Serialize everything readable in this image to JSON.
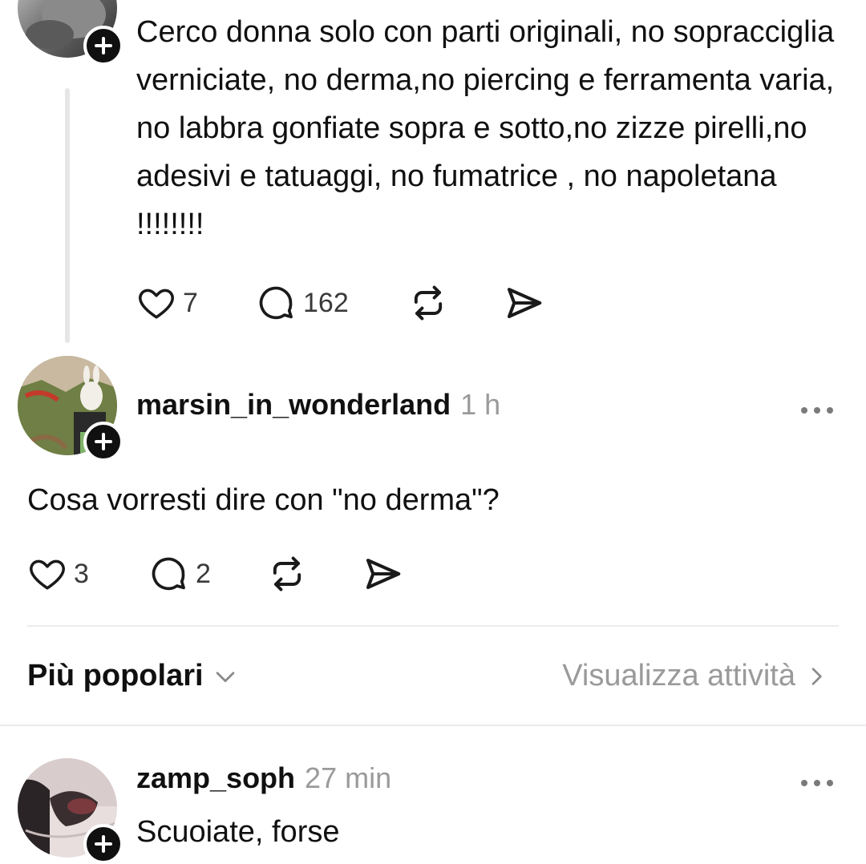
{
  "thread": {
    "original_post": {
      "text": "Cerco donna solo con parti originali, no sopracciglia verniciate, no derma,no piercing e ferramenta varia, no labbra gonfiate sopra e sotto,no zizze pirelli,no adesivi e tatuaggi, no fumatrice , no napoletana !!!!!!!!",
      "likes": "7",
      "replies": "162"
    },
    "reply": {
      "username": "marsin_in_wonderland",
      "time": "1 h",
      "text": "Cosa vorresti dire con \"no derma\"?",
      "likes": "3",
      "replies": "2"
    }
  },
  "sort_bar": {
    "label": "Più popolari",
    "activity_link": "Visualizza attività"
  },
  "comments": [
    {
      "username": "zamp_soph",
      "time": "27 min",
      "text": "Scuoiate, forse"
    }
  ],
  "icons": {
    "like": "heart-icon",
    "reply": "comment-bubble-icon",
    "repost": "repost-icon",
    "share": "send-icon",
    "follow": "plus-icon",
    "more": "more-dots-icon",
    "chevron_down": "chevron-down-icon",
    "chevron_right": "chevron-right-icon"
  }
}
